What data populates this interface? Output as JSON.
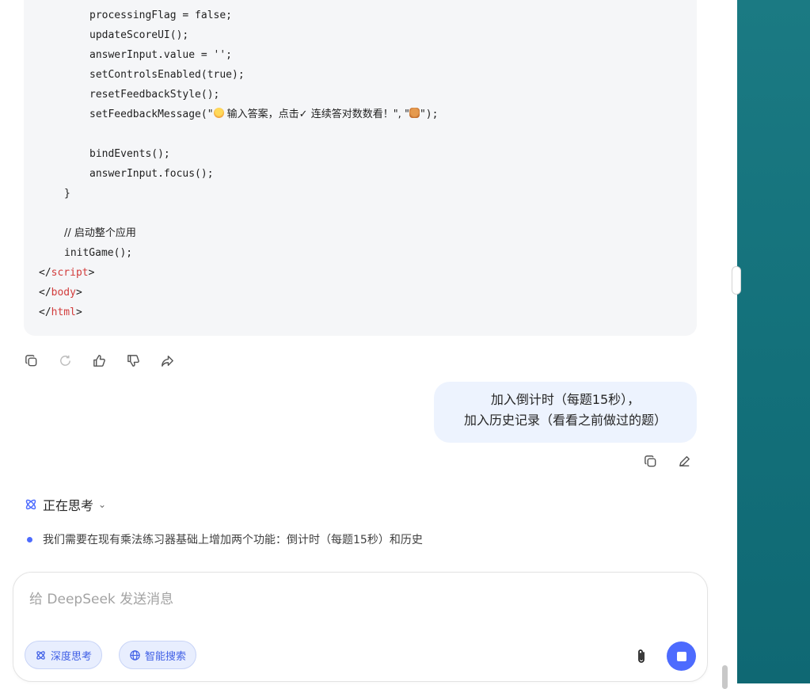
{
  "code": {
    "lines": [
      {
        "text": "processingFlag = false;",
        "indent": 2
      },
      {
        "text": "updateScoreUI();",
        "indent": 2
      },
      {
        "text": "answerInput.value = '';",
        "indent": 2
      },
      {
        "text": "setControlsEnabled(true);",
        "indent": 2
      },
      {
        "text": "resetFeedbackStyle();",
        "indent": 2
      },
      {
        "text": "bindEvents();",
        "indent": 2
      },
      {
        "text": "answerInput.focus();",
        "indent": 2
      },
      {
        "text": "}",
        "indent": 1
      },
      {
        "text": "// 启动整个应用",
        "indent": 1
      },
      {
        "text": "initGame();",
        "indent": 1
      }
    ],
    "feedback_prefix": "setFeedbackMessage(\"",
    "feedback_text": " 输入答案，点击✓ 连续答对数数看！\", \"",
    "feedback_suffix": "\");",
    "close_script": "script",
    "close_body": "body",
    "close_html": "html"
  },
  "actions": {
    "copy": "copy-icon",
    "regenerate": "refresh-icon",
    "like": "thumbs-up-icon",
    "dislike": "thumbs-down-icon",
    "share": "share-icon"
  },
  "user_message": {
    "line1": "加入倒计时（每题15秒），",
    "line2": "加入历史记录（看看之前做过的题）"
  },
  "thinking": {
    "label": "正在思考",
    "bullet": "我们需要在现有乘法练习器基础上增加两个功能：倒计时（每题15秒）和历史"
  },
  "composer": {
    "placeholder": "给 DeepSeek 发送消息",
    "deep_think": "深度思考",
    "web_search": "智能搜索"
  },
  "colors": {
    "accent": "#4d6bfe",
    "side_panel": "#13707a",
    "bubble": "#edf3fe",
    "code_bg": "#f5f6f8"
  }
}
